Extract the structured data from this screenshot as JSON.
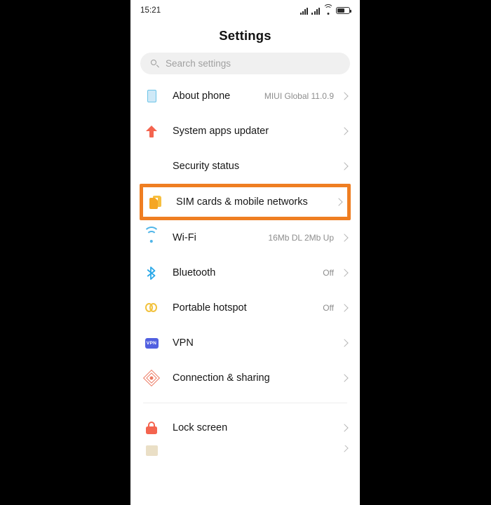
{
  "statusbar": {
    "time": "15:21",
    "icons": [
      "signal-1",
      "signal-2",
      "wifi",
      "battery"
    ]
  },
  "header": {
    "title": "Settings"
  },
  "search": {
    "placeholder": "Search settings",
    "icon": "search-icon"
  },
  "highlight": {
    "color": "#ef7e22",
    "target": "SIM cards & mobile networks"
  },
  "list": [
    {
      "label": "About phone",
      "value": "MIUI Global 11.0.9",
      "icon": "phone-icon",
      "highlighted": false
    },
    {
      "label": "System apps updater",
      "value": "",
      "icon": "up-arrow-icon",
      "highlighted": false
    },
    {
      "label": "Security status",
      "value": "",
      "icon": "shield-check-icon",
      "highlighted": false
    },
    {
      "label": "SIM cards & mobile networks",
      "value": "",
      "icon": "sim-card-icon",
      "highlighted": true
    },
    {
      "label": "Wi-Fi",
      "value": "16Mb DL 2Mb Up",
      "icon": "wifi-icon",
      "highlighted": false
    },
    {
      "label": "Bluetooth",
      "value": "Off",
      "icon": "bluetooth-icon",
      "highlighted": false
    },
    {
      "label": "Portable hotspot",
      "value": "Off",
      "icon": "hotspot-icon",
      "highlighted": false
    },
    {
      "label": "VPN",
      "value": "",
      "icon": "vpn-icon",
      "highlighted": false
    },
    {
      "label": "Connection & sharing",
      "value": "",
      "icon": "connection-sharing-icon",
      "highlighted": false
    }
  ],
  "list2": [
    {
      "label": "Lock screen",
      "value": "",
      "icon": "lock-icon"
    }
  ],
  "vpn_badge_text": "VPN"
}
